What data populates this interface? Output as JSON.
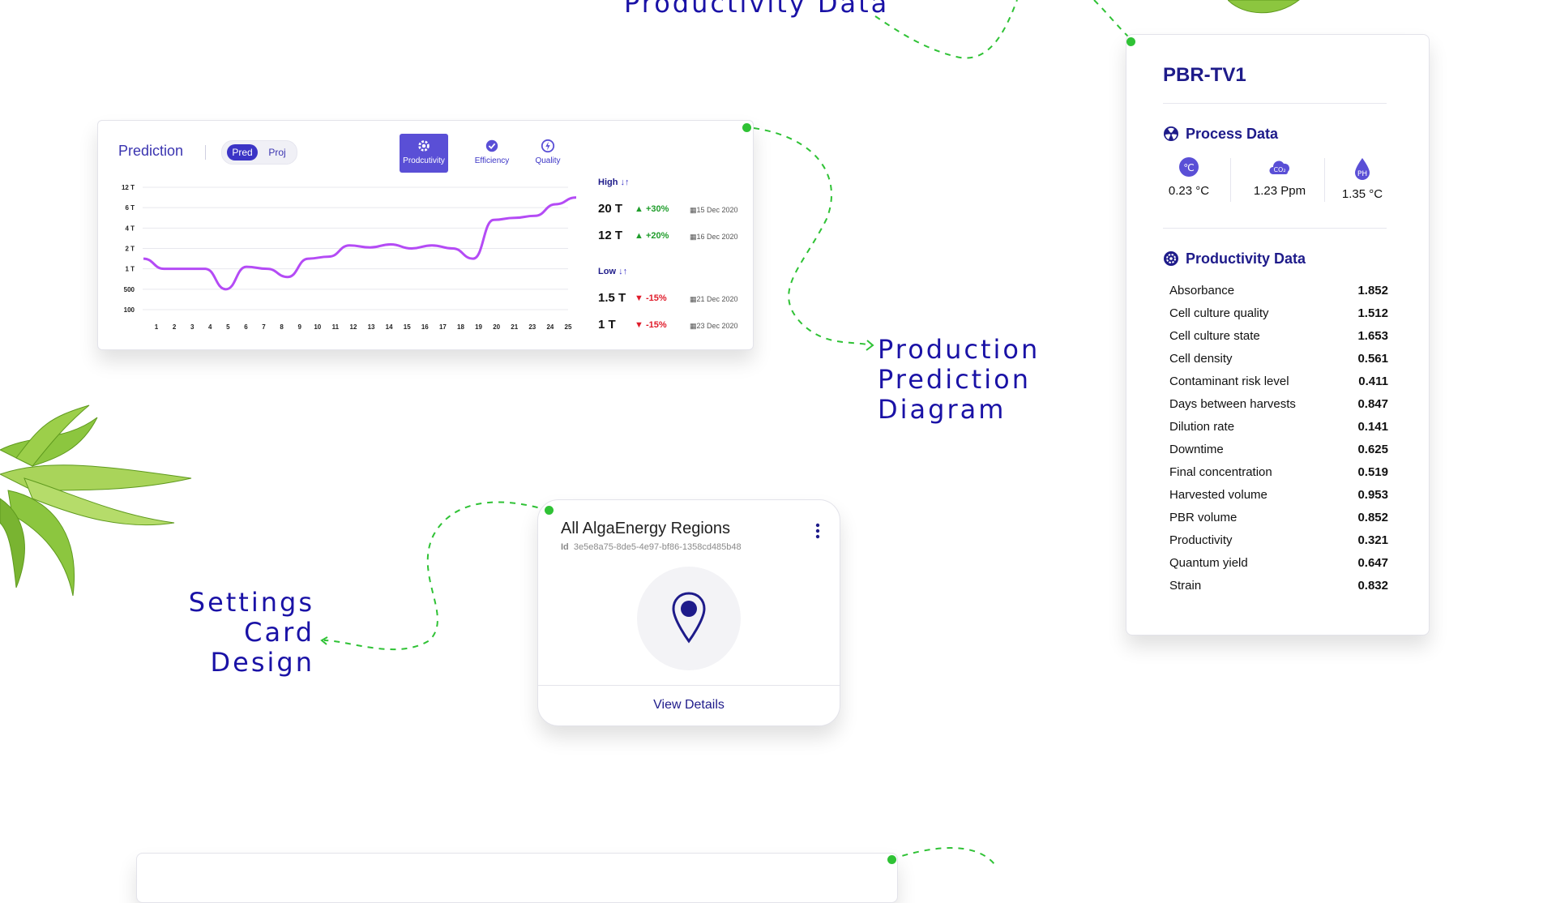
{
  "headlines": {
    "top": "Productivity Data",
    "prediction_lines": [
      "Production",
      "Prediction",
      "Diagram"
    ],
    "settings_lines": [
      "Settings Card",
      "Design"
    ]
  },
  "colors": {
    "brand": "#1a12a6",
    "accent": "#5a4fd6",
    "line": "#b44bf5",
    "dash": "#2fc235",
    "up": "#1f9d2b",
    "down": "#e01b2a"
  },
  "prediction": {
    "title": "Prediction",
    "toggle": {
      "on": "Pred",
      "off": "Proj"
    },
    "tabs": [
      {
        "label": "Prodcutivity",
        "icon": "gear-icon"
      },
      {
        "label": "Efficiency",
        "icon": "badge-check-icon"
      },
      {
        "label": "Quality",
        "icon": "bolt-circle-icon"
      }
    ],
    "high_label": "High",
    "low_label": "Low",
    "high": [
      {
        "value": "20 T",
        "change": "+30%",
        "date": "15 Dec 2020"
      },
      {
        "value": "12 T",
        "change": "+20%",
        "date": "16 Dec 2020"
      }
    ],
    "low": [
      {
        "value": "1.5 T",
        "change": "-15%",
        "date": "21 Dec 2020"
      },
      {
        "value": "1 T",
        "change": "-15%",
        "date": "23 Dec 2020"
      }
    ]
  },
  "chart_data": {
    "type": "line",
    "x": [
      "1",
      "2",
      "3",
      "4",
      "5",
      "6",
      "7",
      "8",
      "9",
      "10",
      "11",
      "12",
      "13",
      "14",
      "15",
      "16",
      "17",
      "18",
      "19",
      "20",
      "21",
      "23",
      "24",
      "25"
    ],
    "ytick_labels": [
      "12 T",
      "6 T",
      "4 T",
      "2 T",
      "1 T",
      "500",
      "100"
    ],
    "series": [
      {
        "values": [
          1.5,
          1,
          1,
          1,
          0.5,
          1.1,
          1,
          0.8,
          1.5,
          1.6,
          2.3,
          2.1,
          2.4,
          2,
          2.3,
          2,
          1.5,
          4.8,
          5,
          5.2,
          7,
          9
        ]
      }
    ],
    "grid": true
  },
  "settings": {
    "title": "All AlgaEnergy Regions",
    "id_label": "Id",
    "id_value": "3e5e8a75-8de5-4e97-bf86-1358cd485b48",
    "action": "View Details"
  },
  "pbr": {
    "title": "PBR-TV1",
    "process_title": "Process Data",
    "process": [
      {
        "icon": "celsius-icon",
        "value": "0.23 °C"
      },
      {
        "icon": "co2-icon",
        "value": "1.23 Ppm"
      },
      {
        "icon": "ph-drop-icon",
        "value": "1.35 °C"
      }
    ],
    "productivity_title": "Productivity Data",
    "rows": [
      {
        "label": "Absorbance",
        "value": "1.852"
      },
      {
        "label": "Cell culture quality",
        "value": "1.512"
      },
      {
        "label": "Cell culture state",
        "value": "1.653"
      },
      {
        "label": "Cell density",
        "value": "0.561"
      },
      {
        "label": "Contaminant risk level",
        "value": "0.411"
      },
      {
        "label": "Days between harvests",
        "value": "0.847"
      },
      {
        "label": "Dilution rate",
        "value": "0.141"
      },
      {
        "label": "Downtime",
        "value": "0.625"
      },
      {
        "label": "Final concentration",
        "value": "0.519"
      },
      {
        "label": "Harvested volume",
        "value": "0.953"
      },
      {
        "label": "PBR volume",
        "value": "0.852"
      },
      {
        "label": "Productivity",
        "value": "0.321"
      },
      {
        "label": "Quantum yield",
        "value": "0.647"
      },
      {
        "label": "Strain",
        "value": "0.832"
      }
    ]
  }
}
